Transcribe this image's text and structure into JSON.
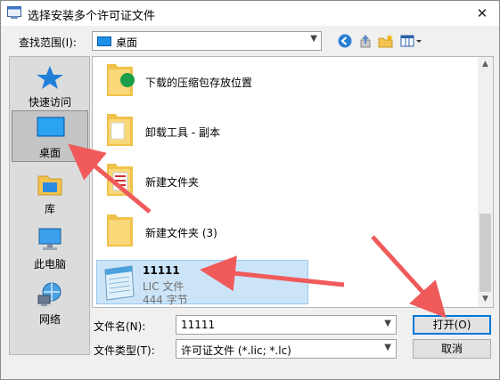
{
  "dialog": {
    "title": "选择安装多个许可证文件",
    "close_label": "✕"
  },
  "lookin": {
    "label": "查找范围(I):",
    "value": "桌面"
  },
  "toolbar": {
    "icons": [
      "back-icon",
      "up-folder-icon",
      "new-folder-icon",
      "view-menu-icon"
    ]
  },
  "places": [
    {
      "label": "快速访问",
      "icon": "star-icon"
    },
    {
      "label": "桌面",
      "icon": "desktop-icon",
      "selected": true
    },
    {
      "label": "库",
      "icon": "library-icon"
    },
    {
      "label": "此电脑",
      "icon": "computer-icon"
    },
    {
      "label": "网络",
      "icon": "network-icon"
    }
  ],
  "files": [
    {
      "name": "下载的压缩包存放位置",
      "icon": "folder-icon"
    },
    {
      "name": "卸载工具 - 副本",
      "icon": "folder-icon"
    },
    {
      "name": "新建文件夹",
      "icon": "folder-icon"
    },
    {
      "name": "新建文件夹 (3)",
      "icon": "folder-icon"
    },
    {
      "name": "11111",
      "type": "LIC 文件",
      "size": "444 字节",
      "icon": "notepad-file-icon",
      "selected": true
    }
  ],
  "filename": {
    "label": "文件名(N):",
    "value": "11111"
  },
  "filetype": {
    "label": "文件类型(T):",
    "value": "许可证文件 (*.lic; *.lc)"
  },
  "buttons": {
    "open": "打开(O)",
    "cancel": "取消"
  },
  "colors": {
    "selection": "#cce4f7",
    "annotation_arrow": "#f05a5a",
    "default_button_border": "#0078d7"
  }
}
